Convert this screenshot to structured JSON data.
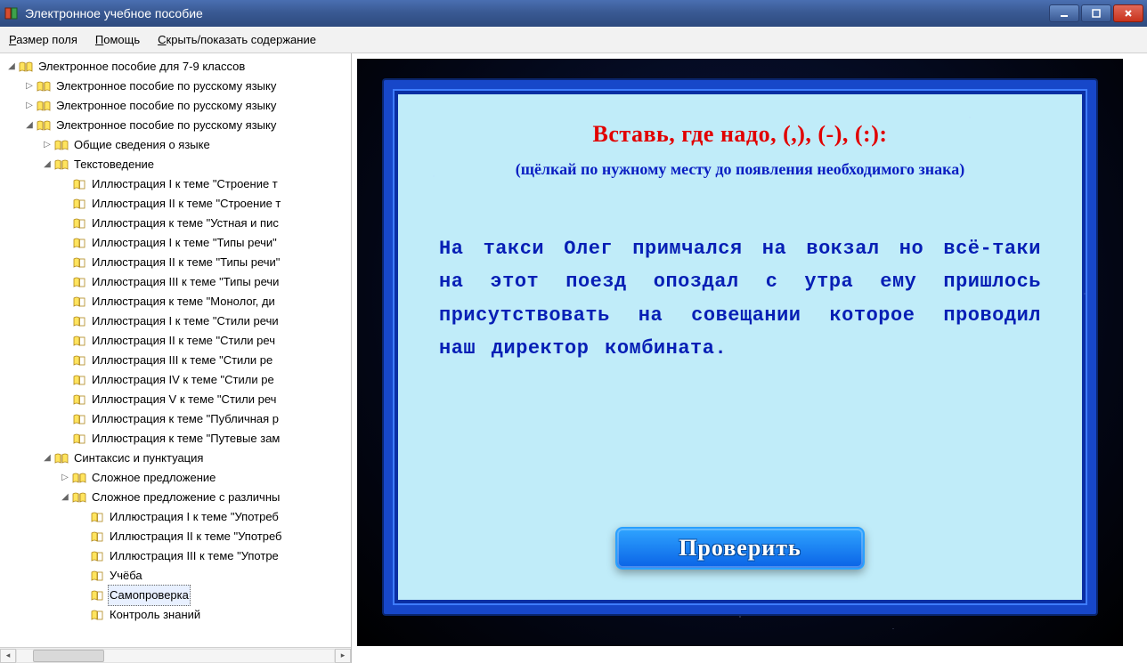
{
  "window": {
    "title": "Электронное учебное пособие"
  },
  "menu": {
    "field_size": "Размер поля",
    "help": "Помощь",
    "toggle_toc": "Скрыть/показать содержание"
  },
  "tree": [
    {
      "level": 0,
      "expander": "open",
      "icon": "open",
      "label": "Электронное пособие для 7-9 классов"
    },
    {
      "level": 1,
      "expander": "closed",
      "icon": "open",
      "label": "Электронное пособие по русскому языку"
    },
    {
      "level": 1,
      "expander": "closed",
      "icon": "open",
      "label": "Электронное пособие по русскому языку"
    },
    {
      "level": 1,
      "expander": "open",
      "icon": "open",
      "label": "Электронное пособие по русскому языку"
    },
    {
      "level": 2,
      "expander": "closed",
      "icon": "open",
      "label": "Общие сведения о языке"
    },
    {
      "level": 2,
      "expander": "open",
      "icon": "open",
      "label": "Текстоведение"
    },
    {
      "level": 3,
      "expander": "none",
      "icon": "page",
      "label": "Иллюстрация I к теме \"Строение т"
    },
    {
      "level": 3,
      "expander": "none",
      "icon": "page",
      "label": "Иллюстрация II к теме \"Строение т"
    },
    {
      "level": 3,
      "expander": "none",
      "icon": "page",
      "label": "Иллюстрация к теме \"Устная и пис"
    },
    {
      "level": 3,
      "expander": "none",
      "icon": "page",
      "label": "Иллюстрация I к теме \"Типы речи\""
    },
    {
      "level": 3,
      "expander": "none",
      "icon": "page",
      "label": "Иллюстрация II к теме \"Типы речи\""
    },
    {
      "level": 3,
      "expander": "none",
      "icon": "page",
      "label": "Иллюстрация III к теме \"Типы речи"
    },
    {
      "level": 3,
      "expander": "none",
      "icon": "page",
      "label": "Иллюстрация к теме \"Монолог, ди"
    },
    {
      "level": 3,
      "expander": "none",
      "icon": "page",
      "label": "Иллюстрация I к теме \"Стили речи"
    },
    {
      "level": 3,
      "expander": "none",
      "icon": "page",
      "label": "Иллюстрация II к теме \"Стили реч"
    },
    {
      "level": 3,
      "expander": "none",
      "icon": "page",
      "label": "Иллюстрация III к теме \"Стили ре"
    },
    {
      "level": 3,
      "expander": "none",
      "icon": "page",
      "label": "Иллюстрация IV к теме \"Стили ре"
    },
    {
      "level": 3,
      "expander": "none",
      "icon": "page",
      "label": "Иллюстрация V к теме \"Стили реч"
    },
    {
      "level": 3,
      "expander": "none",
      "icon": "page",
      "label": "Иллюстрация к теме \"Публичная р"
    },
    {
      "level": 3,
      "expander": "none",
      "icon": "page",
      "label": "Иллюстрация к теме \"Путевые зам"
    },
    {
      "level": 2,
      "expander": "open",
      "icon": "open",
      "label": "Синтаксис и пунктуация"
    },
    {
      "level": 3,
      "expander": "closed",
      "icon": "open",
      "label": "Сложное предложение"
    },
    {
      "level": 3,
      "expander": "open",
      "icon": "open",
      "label": "Сложное предложение с различны"
    },
    {
      "level": 4,
      "expander": "none",
      "icon": "page",
      "label": "Иллюстрация I к теме \"Употреб"
    },
    {
      "level": 4,
      "expander": "none",
      "icon": "page",
      "label": "Иллюстрация II к теме \"Употреб"
    },
    {
      "level": 4,
      "expander": "none",
      "icon": "page",
      "label": "Иллюстрация III к теме \"Употре"
    },
    {
      "level": 4,
      "expander": "none",
      "icon": "page",
      "label": "Учёба"
    },
    {
      "level": 4,
      "expander": "none",
      "icon": "page",
      "label": "Самопроверка",
      "selected": true
    },
    {
      "level": 4,
      "expander": "none",
      "icon": "page",
      "label": "Контроль знаний"
    }
  ],
  "content": {
    "heading": "Вставь, где надо, (,), (-), (:):",
    "subheading": "(щёлкай по нужному месту до появления необходимого знака)",
    "body": "На такси Олег примчался на вокзал но всё-таки на этот поезд опоздал с утра ему пришлось присутствовать на совещании которое проводил наш директор комбината.",
    "check_button": "Проверить"
  }
}
